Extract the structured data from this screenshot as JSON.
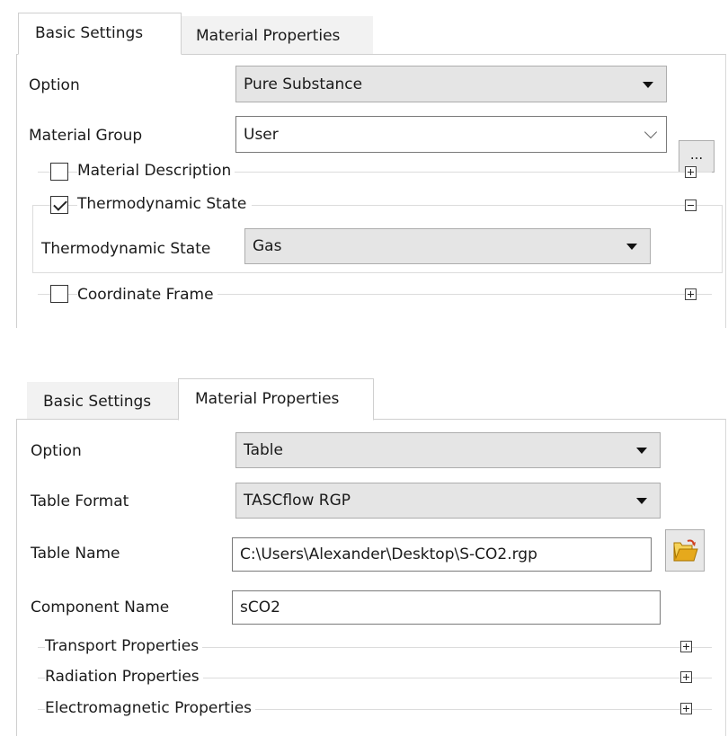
{
  "panel1": {
    "tabs": [
      {
        "label": "Basic Settings",
        "active": true
      },
      {
        "label": "Material Properties",
        "active": false
      }
    ],
    "option": {
      "label": "Option",
      "value": "Pure Substance"
    },
    "material_group": {
      "label": "Material Group",
      "value": "User",
      "browse_label": "..."
    },
    "material_description": {
      "label": "Material Description",
      "checked": false,
      "expander": "plus"
    },
    "thermodynamic_state_group": {
      "label": "Thermodynamic State",
      "checked": true,
      "expander": "minus"
    },
    "thermodynamic_state": {
      "label": "Thermodynamic State",
      "value": "Gas"
    },
    "coordinate_frame": {
      "label": "Coordinate Frame",
      "checked": false,
      "expander": "plus"
    }
  },
  "panel2": {
    "tabs": [
      {
        "label": "Basic Settings",
        "active": false
      },
      {
        "label": "Material Properties",
        "active": true
      }
    ],
    "option": {
      "label": "Option",
      "value": "Table"
    },
    "table_format": {
      "label": "Table Format",
      "value": "TASCflow RGP"
    },
    "table_name": {
      "label": "Table Name",
      "value": "C:\\Users\\Alexander\\Desktop\\S-CO2.rgp"
    },
    "component_name": {
      "label": "Component Name",
      "value": "sCO2"
    },
    "sections": [
      {
        "label": "Transport Properties",
        "expander": "plus"
      },
      {
        "label": "Radiation Properties",
        "expander": "plus"
      },
      {
        "label": "Electromagnetic Properties",
        "expander": "plus"
      }
    ]
  },
  "colors": {
    "combo_bg": "#e5e5e5",
    "field_border": "#7a7a7a",
    "folder": "#f2c230"
  }
}
